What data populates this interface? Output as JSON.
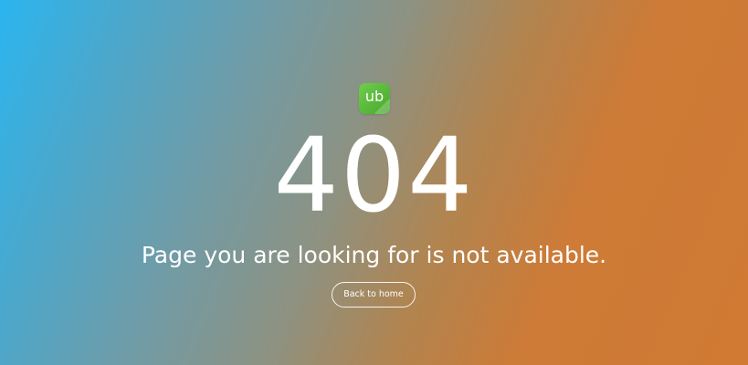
{
  "logo": {
    "text": "ub",
    "color": "#5cbf3f"
  },
  "error": {
    "code": "404",
    "message": "Page you are looking for is not available."
  },
  "actions": {
    "back_label": "Back to home"
  },
  "theme": {
    "gradient_start": "#2bb5ef",
    "gradient_end": "#d07a34",
    "text_color": "#ffffff"
  }
}
